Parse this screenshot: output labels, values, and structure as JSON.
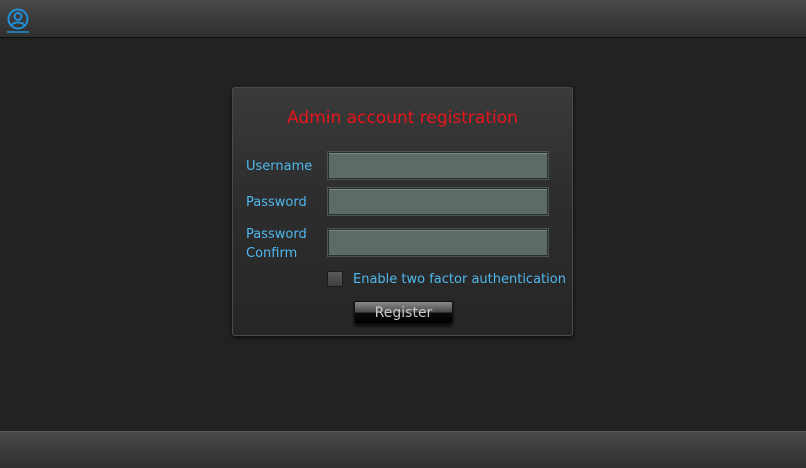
{
  "header": {
    "icon": "user-circle-icon"
  },
  "form": {
    "title": "Admin account registration",
    "fields": {
      "username": {
        "label": "Username",
        "value": ""
      },
      "password": {
        "label": "Password",
        "value": ""
      },
      "password_confirm": {
        "label_line1": "Password",
        "label_line2": "Confirm",
        "value": ""
      }
    },
    "two_factor": {
      "label": "Enable two factor authentication",
      "checked": false
    },
    "submit_label": "Register"
  },
  "colors": {
    "title": "#e8141b",
    "label": "#4fb8ee",
    "icon": "#1f8fd6",
    "input_bg": "#5c6b67",
    "background": "#222222"
  }
}
